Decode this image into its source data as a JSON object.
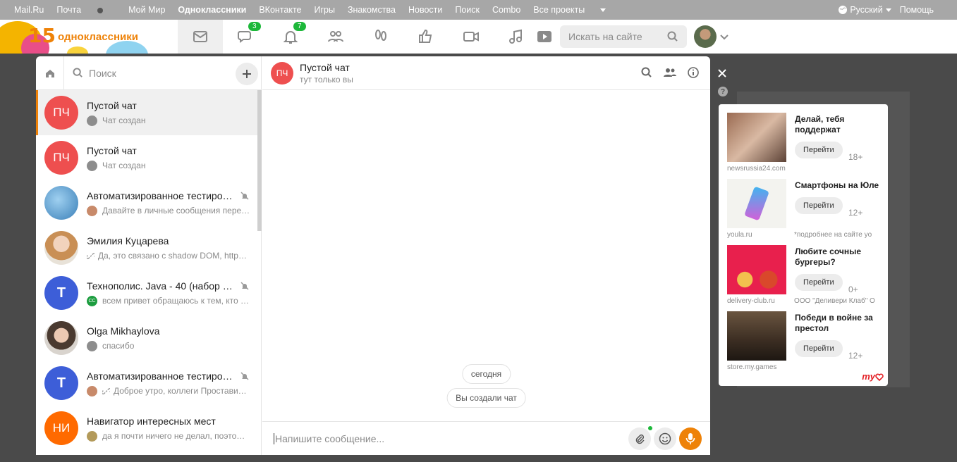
{
  "portal": {
    "links": [
      "Mail.Ru",
      "Почта",
      "Мой Мир",
      "Одноклассники",
      "ВКонтакте",
      "Игры",
      "Знакомства",
      "Новости",
      "Поиск",
      "Combo"
    ],
    "all_projects": "Все проекты",
    "language": "Русский",
    "help": "Помощь"
  },
  "header": {
    "logo_num": "15",
    "logo_word": "одноклассники",
    "messages_badge": "3",
    "notifications_badge": "7",
    "search_placeholder": "Искать на сайте"
  },
  "sidebar": {
    "search_placeholder": "Поиск",
    "chats": [
      {
        "initials": "ПЧ",
        "name": "Пустой чат",
        "last": "Чат создан",
        "color": "#ee4f4f"
      },
      {
        "initials": "ПЧ",
        "name": "Пустой чат",
        "last": "Чат создан",
        "color": "#ee4f4f"
      },
      {
        "initials": "",
        "name": "Автоматизированное тестиро…",
        "last": "Давайте в личные сообщения пере…",
        "color": "#4a8fc7"
      },
      {
        "initials": "",
        "name": "Эмилия Куцарева",
        "last": "Да, это связано с shadow DOM, https…",
        "color": "#d8b99c"
      },
      {
        "initials": "T",
        "name": "Технополис. Java - 40 (набор …",
        "last": "всем привет обращаюсь к тем, кто …",
        "color": "#3d5ed8",
        "mini_text": "CC"
      },
      {
        "initials": "",
        "name": "Olga Mikhaylova",
        "last": "спасибо",
        "color": "#cfc9c2"
      },
      {
        "initials": "T",
        "name": "Автоматизированное тестиро…",
        "last": "Доброе утро, коллеги Проставил…",
        "color": "#3d5ed8"
      },
      {
        "initials": "НИ",
        "name": "Навигатор интересных мест",
        "last": "да я почти ничего не делал, поэтом…",
        "color": "#ff6a00"
      }
    ]
  },
  "conversation": {
    "initials": "ПЧ",
    "title": "Пустой чат",
    "subtitle": "тут только вы",
    "date_pill": "сегодня",
    "event_pill": "Вы создали чат",
    "composer_placeholder": "Напишите сообщение..."
  },
  "ads": [
    {
      "title": "Делай, тебя поддержат",
      "button": "Перейти",
      "age": "18+",
      "domain": "newsrussia24.com",
      "org": ""
    },
    {
      "title": "Смартфоны на Юле",
      "button": "Перейти",
      "age": "12+",
      "domain": "youla.ru",
      "org": "*подробнее на сайте yo"
    },
    {
      "title": "Любите сочные бургеры?",
      "button": "Перейти",
      "age": "0+",
      "domain": "delivery-club.ru",
      "org": "ООО \"Деливери Клаб\" О"
    },
    {
      "title": "Победи в войне за престол",
      "button": "Перейти",
      "age": "12+",
      "domain": "store.my.games",
      "org": ""
    }
  ],
  "ads_logo": "my"
}
